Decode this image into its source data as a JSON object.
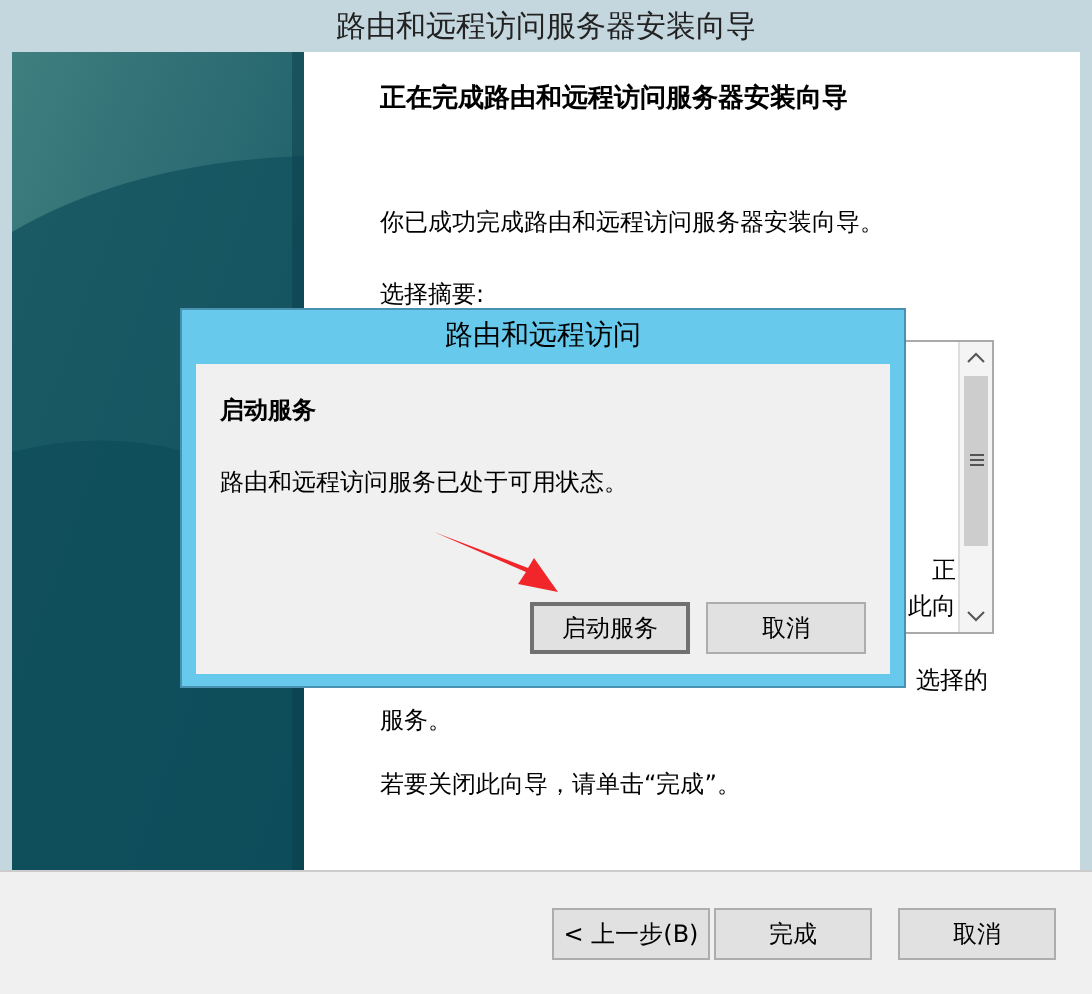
{
  "window": {
    "title": "路由和远程访问服务器安装向导"
  },
  "wizard": {
    "heading": "正在完成路由和远程访问服务器安装向导",
    "intro": "你已成功完成路由和远程访问服务器安装向导。",
    "summary_label": "选择摘要:",
    "summary_lines": [
      "正",
      "此向"
    ],
    "note_tail": "选择的",
    "note_cont": "服务。",
    "close_hint": "若要关闭此向导，请单击“完成”。"
  },
  "buttons": [
    {
      "label": "< 上一步(B)",
      "default": false
    },
    {
      "label": "完成",
      "default": false
    },
    {
      "label": "取消",
      "default": false
    }
  ],
  "dialog": {
    "title": "路由和远程访问",
    "heading": "启动服务",
    "message": "路由和远程访问服务已处于可用状态。",
    "buttons": [
      {
        "label": "启动服务",
        "default": true
      },
      {
        "label": "取消",
        "default": false
      }
    ]
  }
}
